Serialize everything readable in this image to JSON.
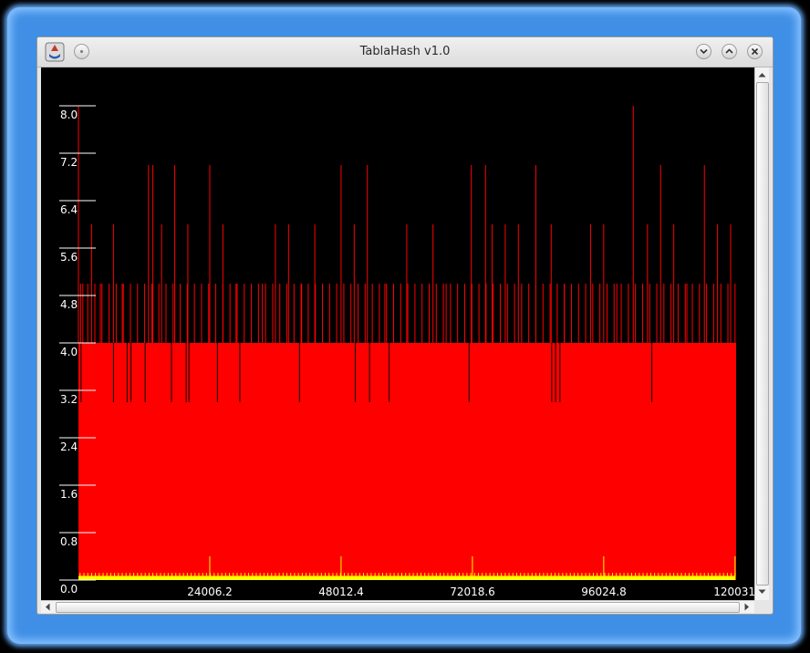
{
  "window": {
    "title": "TablaHash v1.0",
    "buttons": [
      "menu",
      "minimize",
      "maximize",
      "close"
    ]
  },
  "icons": {
    "app": "java-app-icon",
    "menu": "circle-menu-icon",
    "minimize": "chevron-down-icon",
    "maximize": "chevron-up-icon",
    "close": "close-icon",
    "scroll_up": "arrow-up-icon",
    "scroll_down": "arrow-down-icon",
    "scroll_left": "arrow-left-icon",
    "scroll_right": "arrow-right-icon"
  },
  "colors": {
    "background": "#000000",
    "series_red": "#ff0000",
    "series_yellow": "#ffff00",
    "axis": "#ffffff",
    "window_glow": "#3f8fe6"
  },
  "chart_data": {
    "type": "bar",
    "title": "",
    "xlabel": "",
    "ylabel": "",
    "ylim": [
      0,
      8.0
    ],
    "xlim": [
      0,
      120031
    ],
    "yticks": [
      "0.0",
      "0.8",
      "1.6",
      "2.4",
      "3.2",
      "4.0",
      "4.8",
      "5.6",
      "6.4",
      "7.2",
      "8.0"
    ],
    "xticks": [
      "24006.2",
      "48012.4",
      "72018.6",
      "96024.8",
      "120031"
    ],
    "grid": false,
    "legend": "none",
    "series": [
      {
        "color": "#ff0000",
        "baseline_value": 4,
        "dip_values_at_x": [
          480,
          6400,
          8900,
          9600,
          12200,
          17000,
          19700,
          20200,
          25400,
          29500,
          40400,
          50600,
          53200,
          56800,
          71400,
          86500,
          87200,
          88000,
          104800
        ],
        "spike_values_at_x": [
          {
            "x": 0,
            "y": 8
          },
          {
            "x": 800,
            "y": 5
          },
          {
            "x": 2400,
            "y": 6
          },
          {
            "x": 4000,
            "y": 5
          },
          {
            "x": 6400,
            "y": 6
          },
          {
            "x": 8000,
            "y": 5
          },
          {
            "x": 12800,
            "y": 7
          },
          {
            "x": 13600,
            "y": 7
          },
          {
            "x": 15200,
            "y": 6
          },
          {
            "x": 17600,
            "y": 7
          },
          {
            "x": 20000,
            "y": 6
          },
          {
            "x": 24000,
            "y": 7
          },
          {
            "x": 26400,
            "y": 6
          },
          {
            "x": 28800,
            "y": 5
          },
          {
            "x": 33600,
            "y": 5
          },
          {
            "x": 36000,
            "y": 6
          },
          {
            "x": 38400,
            "y": 6
          },
          {
            "x": 40800,
            "y": 5
          },
          {
            "x": 43200,
            "y": 6
          },
          {
            "x": 48000,
            "y": 7
          },
          {
            "x": 50400,
            "y": 6
          },
          {
            "x": 52800,
            "y": 7
          },
          {
            "x": 56000,
            "y": 5
          },
          {
            "x": 60000,
            "y": 6
          },
          {
            "x": 64800,
            "y": 6
          },
          {
            "x": 67200,
            "y": 5
          },
          {
            "x": 71800,
            "y": 7
          },
          {
            "x": 74400,
            "y": 7
          },
          {
            "x": 75600,
            "y": 6
          },
          {
            "x": 78000,
            "y": 6
          },
          {
            "x": 80400,
            "y": 6
          },
          {
            "x": 83600,
            "y": 7
          },
          {
            "x": 86400,
            "y": 6
          },
          {
            "x": 88800,
            "y": 5
          },
          {
            "x": 93600,
            "y": 6
          },
          {
            "x": 96000,
            "y": 6
          },
          {
            "x": 98400,
            "y": 5
          },
          {
            "x": 101400,
            "y": 8
          },
          {
            "x": 104000,
            "y": 6
          },
          {
            "x": 106400,
            "y": 7
          },
          {
            "x": 108800,
            "y": 6
          },
          {
            "x": 111200,
            "y": 5
          },
          {
            "x": 114400,
            "y": 7
          },
          {
            "x": 116800,
            "y": 6
          },
          {
            "x": 119200,
            "y": 6
          }
        ]
      },
      {
        "color": "#ffff00",
        "baseline_value": 0,
        "spike_values_at_x": [
          {
            "x": 24000,
            "y": 0.4
          },
          {
            "x": 48000,
            "y": 0.4
          },
          {
            "x": 72000,
            "y": 0.4
          },
          {
            "x": 96000,
            "y": 0.4
          },
          {
            "x": 120000,
            "y": 0.4
          }
        ]
      }
    ]
  }
}
